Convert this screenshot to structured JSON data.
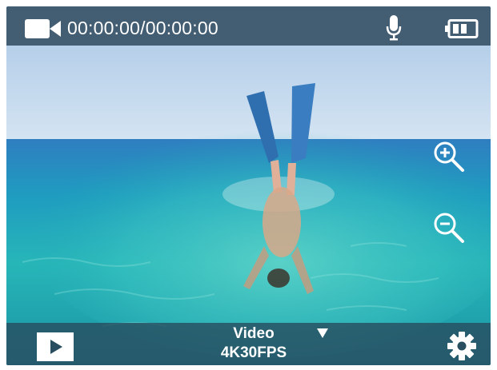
{
  "status_bar": {
    "timer": "00:00:00/00:00:00",
    "icons": [
      "video-camera-icon",
      "microphone-icon",
      "battery-icon"
    ]
  },
  "viewfinder": {
    "controls": [
      "zoom-in-icon",
      "zoom-out-icon"
    ]
  },
  "bottom_bar": {
    "mode_label": "Video",
    "mode_value": "4K30FPS",
    "icons": [
      "play-icon",
      "dropdown-caret-icon",
      "gear-icon"
    ]
  },
  "colors": {
    "top_bar": "#3a5468",
    "bottom_bar": "#284e60",
    "sky": "#b9d2ea",
    "water": "#1ea7b5",
    "icon_white": "#ffffff"
  }
}
